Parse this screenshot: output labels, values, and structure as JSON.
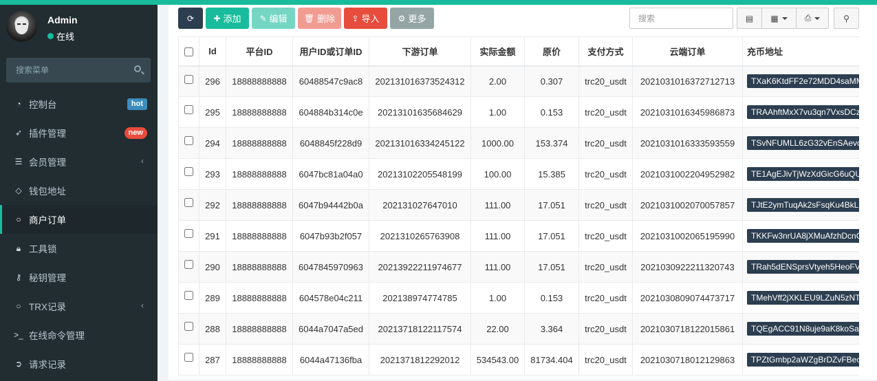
{
  "user": {
    "name": "Admin",
    "status": "在线"
  },
  "sidebar": {
    "search_placeholder": "搜索菜单",
    "items": [
      {
        "label": "控制台",
        "icon": "dashboard-icon",
        "badge": "hot"
      },
      {
        "label": "插件管理",
        "icon": "rocket-icon",
        "badge": "new"
      },
      {
        "label": "会员管理",
        "icon": "list-icon",
        "has_children": true
      },
      {
        "label": "钱包地址",
        "icon": "diamond-icon"
      },
      {
        "label": "商户订单",
        "icon": "circle-icon",
        "active": true
      },
      {
        "label": "工具锁",
        "icon": "lock-icon"
      },
      {
        "label": "秘钥管理",
        "icon": "key-icon"
      },
      {
        "label": "TRX记录",
        "icon": "circle-icon",
        "has_children": true
      },
      {
        "label": "在线命令管理",
        "icon": "terminal-icon"
      },
      {
        "label": "请求记录",
        "icon": "arrow-circle-icon"
      }
    ]
  },
  "toolbar": {
    "add_label": "添加",
    "edit_label": "编辑",
    "delete_label": "删除",
    "import_label": "导入",
    "more_label": "更多",
    "search_placeholder": "搜索"
  },
  "table": {
    "columns": [
      "Id",
      "平台ID",
      "用户ID或订单ID",
      "下游订单",
      "实际金额",
      "原价",
      "支付方式",
      "云端订单",
      "充币地址"
    ],
    "rows": [
      [
        "296",
        "18888888888",
        "60488547c9ac8",
        "202131016373524312",
        "2.00",
        "0.307",
        "trc20_usdt",
        "20210310163727127​13",
        "TXaK6KtdFF2e72MDD4saMM"
      ],
      [
        "295",
        "18888888888",
        "604884b314c0e",
        "20213101635684629",
        "1.00",
        "0.153",
        "trc20_usdt",
        "202103101634598​6873",
        "TRAAhftMxX7vu3qn7VxsDCz"
      ],
      [
        "294",
        "18888888888",
        "6048845f228d9",
        "202131016334245122",
        "1000.00",
        "153.374",
        "trc20_usdt",
        "2021031016333593559",
        "TSvNFUMLL6zG32vEnSAevc"
      ],
      [
        "293",
        "18888888888",
        "6047bc81a04a0",
        "20213102205548199",
        "100.00",
        "15.385",
        "trc20_usdt",
        "2021031002204952982",
        "TE1AgEJivTjWzXdGicG6uQU"
      ],
      [
        "292",
        "18888888888",
        "6047b94442b0a",
        "202131027647010",
        "111.00",
        "17.051",
        "trc20_usdt",
        "2021031002070057857",
        "TJtE2ymTuqAk2sFsqKu4BkL"
      ],
      [
        "291",
        "18888888888",
        "6047b93b2f057",
        "202131026576390​8",
        "111.00",
        "17.051",
        "trc20_usdt",
        "2021031002065195990",
        "TKKFw3nrUA8jXMuAfzhDcnC"
      ],
      [
        "290",
        "18888888888",
        "6047845970963",
        "20213922211974677",
        "111.00",
        "17.051",
        "trc20_usdt",
        "2021030922211320743",
        "TRah5dENSprsVtyeh5HeoFV"
      ],
      [
        "289",
        "18888888888",
        "604578e04c211",
        "202138974774785",
        "1.00",
        "0.153",
        "trc20_usdt",
        "2021030809074473717",
        "TMehVff2jXKLEU9LZuN5zNT"
      ],
      [
        "288",
        "18888888888",
        "6044a7047a5ed",
        "20213718122117574",
        "22.00",
        "3.364",
        "trc20_usdt",
        "2021030718122015861",
        "TQEgACC91N8uje9aK8koSaj"
      ],
      [
        "287",
        "18888888888",
        "6044a47136fba",
        "2021371812292012",
        "534543.00",
        "81734.404",
        "trc20_usdt",
        "2021030718012129863",
        "TPZtGmbp2aWZgBrDZvFBec"
      ]
    ]
  }
}
